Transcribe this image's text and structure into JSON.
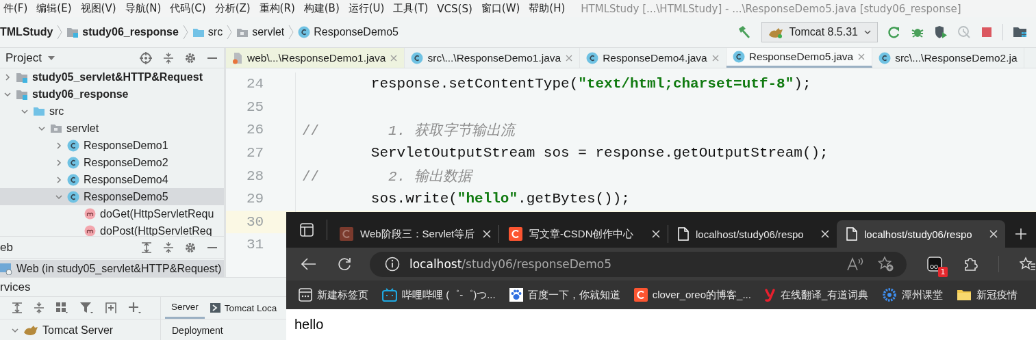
{
  "menu_bar": {
    "items": [
      "件(F)",
      "编辑(E)",
      "视图(V)",
      "导航(N)",
      "代码(C)",
      "分析(Z)",
      "重构(R)",
      "构建(B)",
      "运行(U)",
      "工具(T)",
      "VCS(S)",
      "窗口(W)",
      "帮助(H)"
    ],
    "title": "HTMLStudy [...\\HTMLStudy] - ...\\ResponseDemo5.java [study06_response]"
  },
  "breadcrumbs": [
    {
      "label": "TMLStudy",
      "kind": "project"
    },
    {
      "label": "study06_response",
      "kind": "module"
    },
    {
      "label": "src",
      "kind": "source"
    },
    {
      "label": "servlet",
      "kind": "package"
    },
    {
      "label": "ResponseDemo5",
      "kind": "class"
    }
  ],
  "run_config": {
    "label": "Tomcat 8.5.31"
  },
  "project_panel": {
    "title": "Project",
    "tree": [
      {
        "label": "study05_servlet&HTTP&Request",
        "kind": "module",
        "expanded": false,
        "selected": false
      },
      {
        "label": "study06_response",
        "kind": "module",
        "expanded": true,
        "selected": false,
        "children": [
          {
            "label": "src",
            "kind": "source",
            "expanded": true,
            "selected": false,
            "children": [
              {
                "label": "servlet",
                "kind": "package",
                "expanded": true,
                "selected": false,
                "children": [
                  {
                    "label": "ResponseDemo1",
                    "kind": "class",
                    "expanded": false,
                    "selected": false
                  },
                  {
                    "label": "ResponseDemo2",
                    "kind": "class",
                    "expanded": false,
                    "selected": false
                  },
                  {
                    "label": "ResponseDemo4",
                    "kind": "class",
                    "expanded": false,
                    "selected": false
                  },
                  {
                    "label": "ResponseDemo5",
                    "kind": "class",
                    "expanded": true,
                    "selected": true,
                    "children": [
                      {
                        "label": "doGet(HttpServletRequ",
                        "kind": "method",
                        "selected": false
                      },
                      {
                        "label": "doPost(HttpServletReq",
                        "kind": "method",
                        "selected": false
                      }
                    ]
                  }
                ]
              }
            ]
          }
        ]
      }
    ]
  },
  "editor_tabs": [
    {
      "label": "web\\...\\ResponseDemo1.java",
      "kind": "jsp",
      "selected": false,
      "closable": true
    },
    {
      "label": "src\\...\\ResponseDemo1.java",
      "kind": "class",
      "selected": false,
      "closable": true
    },
    {
      "label": "ResponseDemo4.java",
      "kind": "class",
      "selected": false,
      "closable": true
    },
    {
      "label": "ResponseDemo5.java",
      "kind": "class",
      "selected": true,
      "closable": true
    },
    {
      "label": "src\\...\\ResponseDemo2.ja",
      "kind": "class",
      "selected": false,
      "closable": false
    }
  ],
  "editor": {
    "lines": [
      {
        "number": "24",
        "current": false,
        "tokens": [
          {
            "text": "        response.setContentType(",
            "kind": "plain"
          },
          {
            "text": "\"text/html;charset=utf-8\"",
            "kind": "string"
          },
          {
            "text": ");",
            "kind": "plain"
          }
        ]
      },
      {
        "number": "25",
        "current": false
      },
      {
        "number": "26",
        "current": false,
        "tokens": [
          {
            "text": "//",
            "kind": "comment-mark"
          },
          {
            "text": "        1. 获取字节输出流",
            "kind": "comment"
          }
        ]
      },
      {
        "number": "27",
        "current": false,
        "tokens": [
          {
            "text": "        ServletOutputStream sos = response.getOutputStream();",
            "kind": "plain"
          }
        ]
      },
      {
        "number": "28",
        "current": false,
        "tokens": [
          {
            "text": "//",
            "kind": "comment-mark"
          },
          {
            "text": "        2. 输出数据",
            "kind": "comment"
          }
        ]
      },
      {
        "number": "29",
        "current": false,
        "tokens": [
          {
            "text": "        sos.write(",
            "kind": "plain"
          },
          {
            "text": "\"hello\"",
            "kind": "string"
          },
          {
            "text": ".getBytes());",
            "kind": "plain"
          }
        ]
      },
      {
        "number": "30",
        "current": true
      },
      {
        "number": "31",
        "current": false
      }
    ]
  },
  "web_panel": {
    "title": "eb",
    "items": [
      {
        "label": "Web (in study05_servlet&HTTP&Request)",
        "selected": true
      }
    ]
  },
  "services_panel": {
    "title": "rvices",
    "tabs": [
      {
        "label": "Server",
        "selected": true
      },
      {
        "label": "Tomcat Loca",
        "selected": false
      }
    ],
    "tree": [
      {
        "label": "Tomcat Server",
        "expanded": true
      }
    ],
    "detail_label": "Deployment"
  },
  "browser": {
    "tabs": [
      {
        "title": "Web阶段三：Servlet等后",
        "kind": "c-logo-muted",
        "selected": false
      },
      {
        "title": "写文章-CSDN创作中心",
        "kind": "c-logo",
        "selected": false
      },
      {
        "title": "localhost/study06/respo",
        "kind": "page",
        "selected": false
      },
      {
        "title": "localhost/study06/respo",
        "kind": "page",
        "selected": true
      }
    ],
    "address": {
      "host": "localhost",
      "path": "/study06/responseDemo5"
    },
    "extension_badge": "1",
    "bookmarks": [
      {
        "label": "新建标签页",
        "kind": "new-tab"
      },
      {
        "label": "哔哩哔哩 (゜-゜)つ...",
        "kind": "tv"
      },
      {
        "label": "百度一下，你就知道",
        "kind": "paw"
      },
      {
        "label": "clover_oreo的博客_...",
        "kind": "c-logo"
      },
      {
        "label": "在线翻译_有道词典",
        "kind": "y-logo"
      },
      {
        "label": "潭州课堂",
        "kind": "gear-logo"
      },
      {
        "label": "新冠疫情",
        "kind": "folder"
      }
    ],
    "content": "hello"
  }
}
